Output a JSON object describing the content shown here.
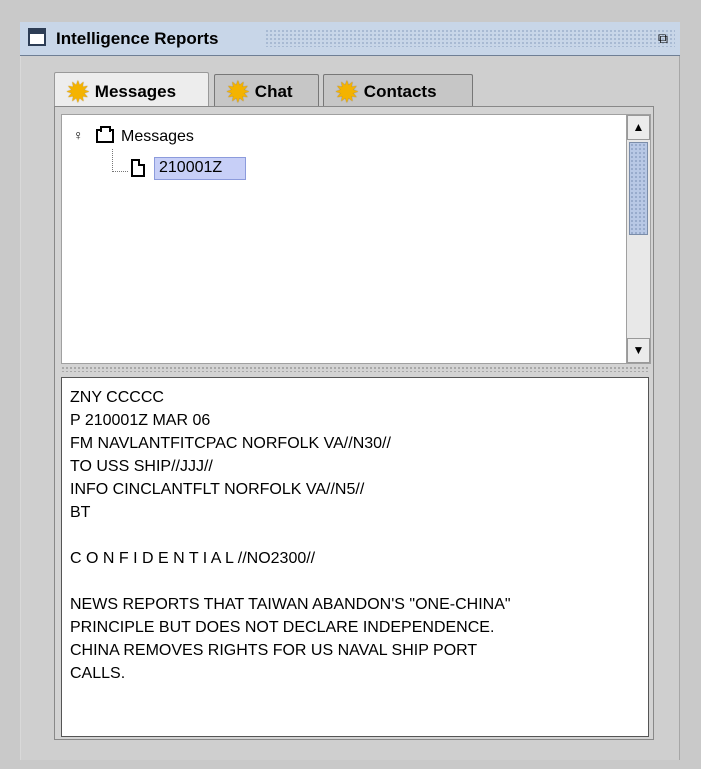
{
  "window": {
    "title": "Intelligence Reports",
    "icon": "window-icon",
    "restore_icon": "restore-icon"
  },
  "tabs": [
    {
      "label": "Messages",
      "icon": "star-icon"
    },
    {
      "label": "Chat",
      "icon": "star-icon"
    },
    {
      "label": "Contacts",
      "icon": "star-icon"
    }
  ],
  "tree": {
    "root_label": "Messages",
    "selected_item": "210001Z"
  },
  "message": {
    "lines": [
      "ZNY CCCCC",
      "P 210001Z MAR 06",
      "FM NAVLANTFITCPAC NORFOLK VA//N30//",
      "TO USS SHIP//JJJ//",
      "INFO CINCLANTFLT NORFOLK VA//N5//",
      "BT",
      "",
      "C O N F I D E N T I A L //NO2300//",
      "",
      "NEWS REPORTS THAT TAIWAN ABANDON'S \"ONE-CHINA\"",
      "PRINCIPLE BUT DOES NOT DECLARE INDEPENDENCE.",
      "CHINA REMOVES RIGHTS FOR US NAVAL SHIP PORT",
      "CALLS."
    ]
  },
  "colors": {
    "selection": "#c7cff7",
    "star": "#f4b300",
    "titlebar": "#c8d6e8"
  }
}
